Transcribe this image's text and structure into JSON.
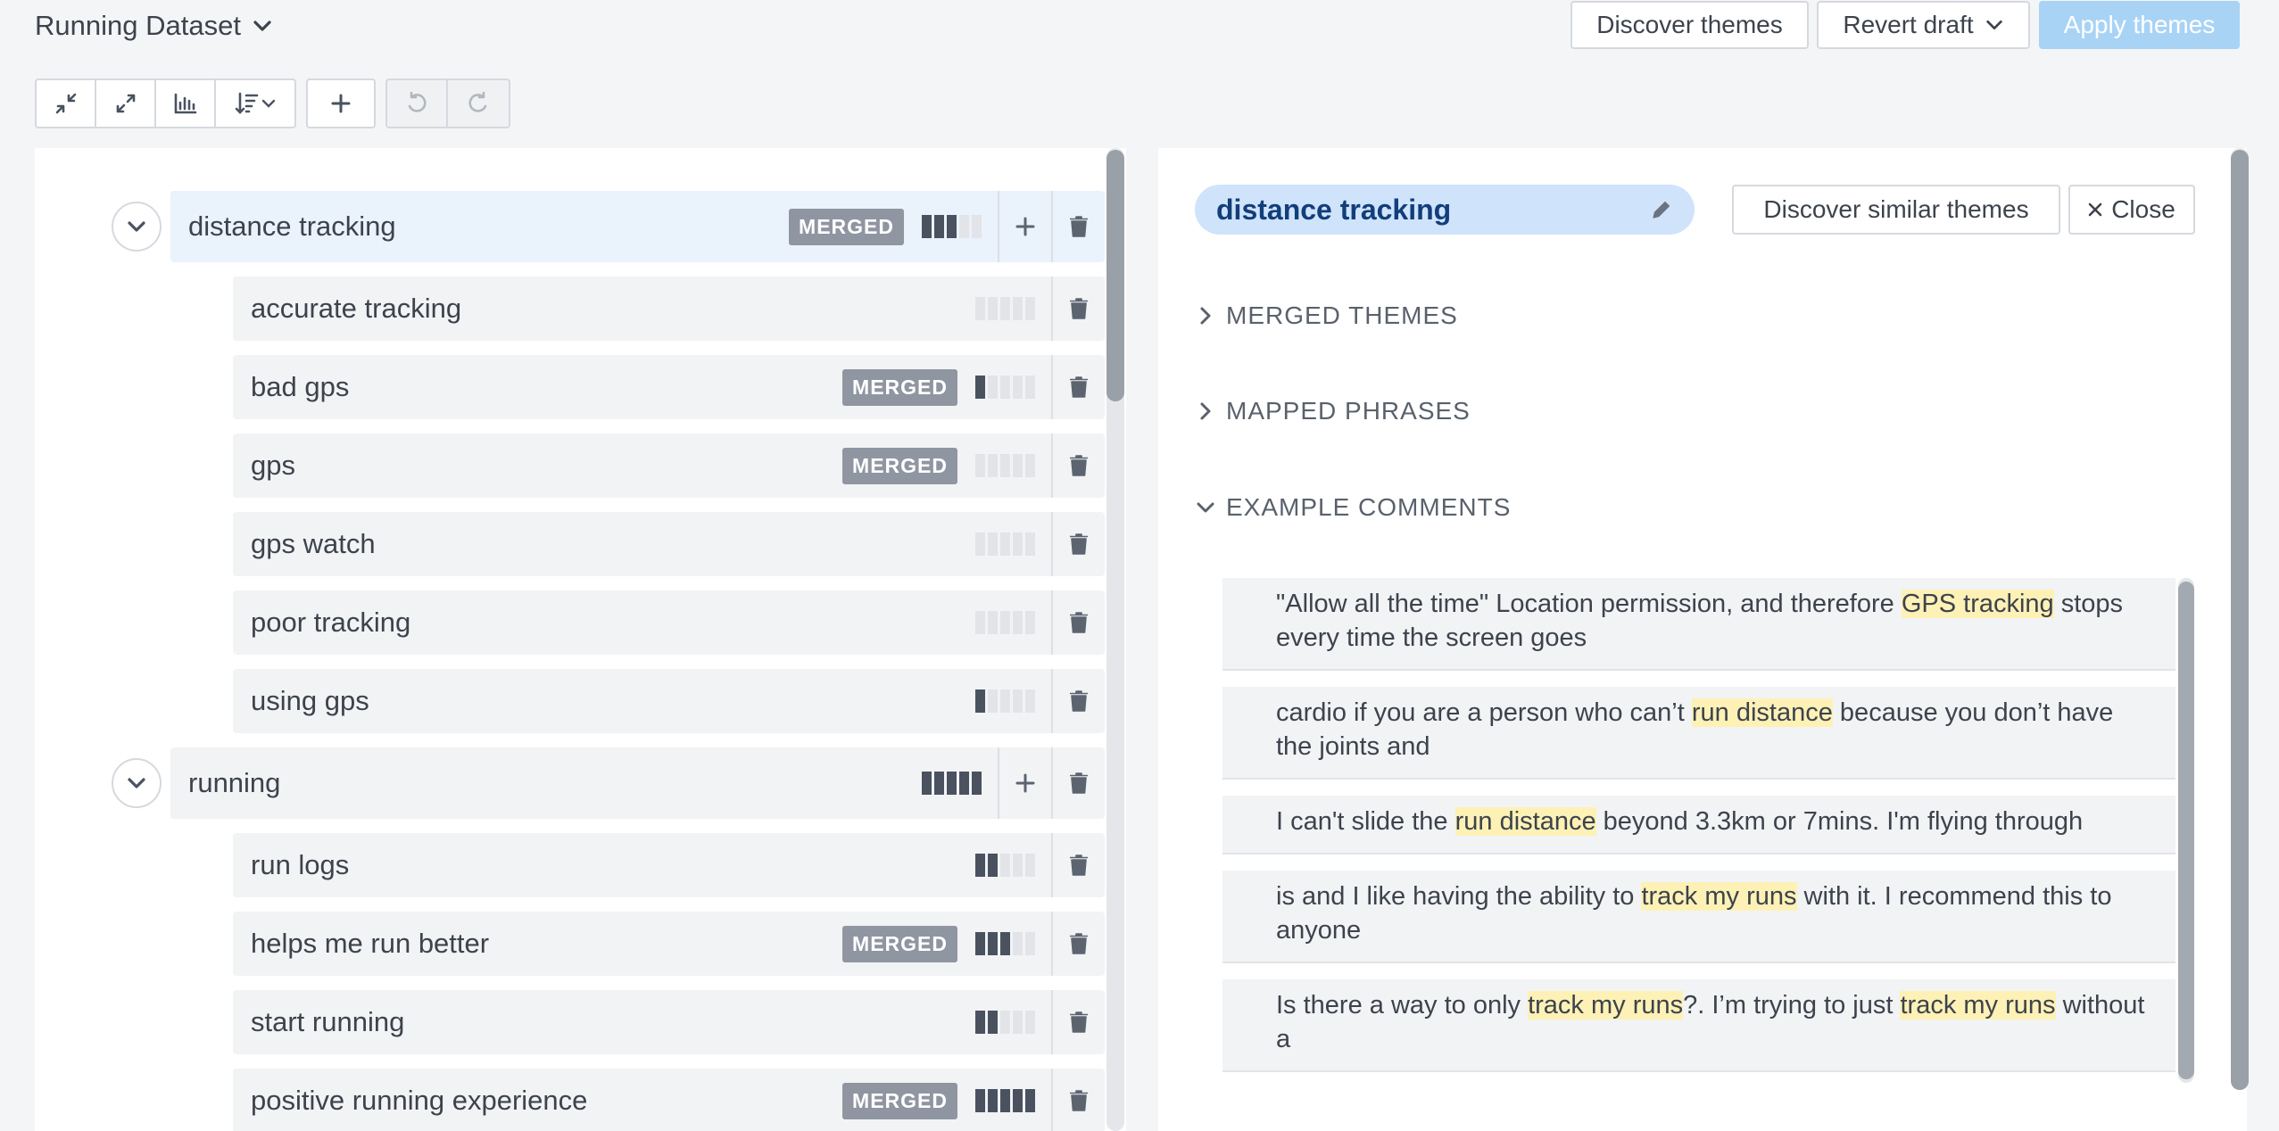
{
  "header": {
    "dataset_title": "Running Dataset",
    "discover_themes": "Discover themes",
    "revert_draft": "Revert draft",
    "apply_themes": "Apply themes"
  },
  "toolbar": {
    "icons": [
      "collapse-icon",
      "expand-icon",
      "bar-chart-icon",
      "sort-icon",
      "plus-icon",
      "undo-icon",
      "redo-icon"
    ]
  },
  "badge_text": "MERGED",
  "themes": [
    {
      "label": "distance tracking",
      "level": "parent",
      "merged": true,
      "meter": 3,
      "selected": true
    },
    {
      "label": "accurate tracking",
      "level": "child",
      "merged": false,
      "meter": 0
    },
    {
      "label": "bad gps",
      "level": "child",
      "merged": true,
      "meter": 1
    },
    {
      "label": "gps",
      "level": "child",
      "merged": true,
      "meter": 0
    },
    {
      "label": "gps watch",
      "level": "child",
      "merged": false,
      "meter": 0
    },
    {
      "label": "poor tracking",
      "level": "child",
      "merged": false,
      "meter": 0
    },
    {
      "label": "using gps",
      "level": "child",
      "merged": false,
      "meter": 1
    },
    {
      "label": "running",
      "level": "parent",
      "merged": false,
      "meter": 5,
      "selected": false
    },
    {
      "label": "run logs",
      "level": "child",
      "merged": false,
      "meter": 2
    },
    {
      "label": "helps me run better",
      "level": "child",
      "merged": true,
      "meter": 3
    },
    {
      "label": "start running",
      "level": "child",
      "merged": false,
      "meter": 2
    },
    {
      "label": "positive running experience",
      "level": "child",
      "merged": true,
      "meter": 5
    }
  ],
  "detail": {
    "theme_name": "distance tracking",
    "discover_similar": "Discover similar themes",
    "close": "Close",
    "sections": {
      "merged_themes": "MERGED THEMES",
      "mapped_phrases": "MAPPED PHRASES",
      "example_comments": "EXAMPLE COMMENTS"
    },
    "comments": [
      {
        "parts": [
          [
            "\"Allow all the time\" Location permission, and therefore ",
            false
          ],
          [
            "GPS tracking",
            true
          ],
          [
            " stops every time the screen goes",
            false
          ]
        ]
      },
      {
        "parts": [
          [
            "cardio if you are a person who can’t ",
            false
          ],
          [
            "run distance",
            true
          ],
          [
            " because you don’t have the joints and",
            false
          ]
        ]
      },
      {
        "parts": [
          [
            "I can't slide the ",
            false
          ],
          [
            "run distance",
            true
          ],
          [
            " beyond 3.3km or 7mins. I'm flying through",
            false
          ]
        ]
      },
      {
        "parts": [
          [
            "is and I like having the ability to ",
            false
          ],
          [
            "track my runs",
            true
          ],
          [
            " with it. I recommend this to anyone",
            false
          ]
        ]
      },
      {
        "parts": [
          [
            "Is there a way to only ",
            false
          ],
          [
            "track my runs",
            true
          ],
          [
            "?. I’m trying to just ",
            false
          ],
          [
            "track my runs",
            true
          ],
          [
            " without a",
            false
          ]
        ]
      }
    ]
  },
  "colors": {
    "accent_blue": "#a8d3f5",
    "selected_pill": "#cfe3fb",
    "highlight": "#fdf1b6",
    "badge": "#8f96a1"
  }
}
